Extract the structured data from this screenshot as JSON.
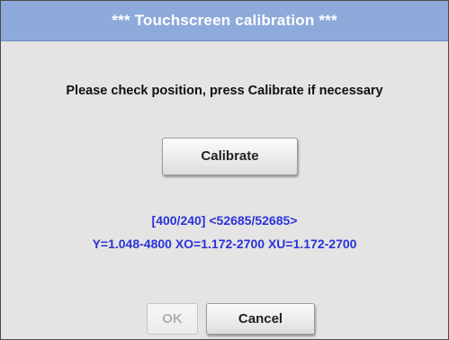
{
  "dialog": {
    "title": "***  Touchscreen calibration  ***",
    "instruction": "Please check position, press Calibrate if necessary",
    "calibrate_label": "Calibrate",
    "position_readout": "[400/240] <52685/52685>",
    "coefficients_readout": "Y=1.048-4800  XO=1.172-2700  XU=1.172-2700",
    "ok_label": "OK",
    "ok_enabled": false,
    "cancel_label": "Cancel"
  },
  "colors": {
    "title_bar": "#8eaadb",
    "background": "#e4e4e4",
    "readout_text": "#2a33d6",
    "disabled_text": "#b0b0b0"
  }
}
